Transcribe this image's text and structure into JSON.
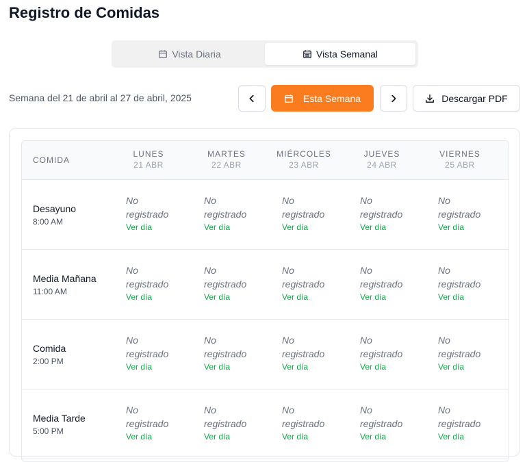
{
  "title": "Registro de Comidas",
  "view_toggle": {
    "daily": "Vista Diaria",
    "weekly": "Vista Semanal",
    "selected": "weekly"
  },
  "week_label": "Semana del 21 de abril al 27 de abril, 2025",
  "controls": {
    "this_week": "Esta Semana",
    "download_pdf": "Descargar PDF"
  },
  "colors": {
    "accent": "#fb7c1f",
    "link": "#16a34a"
  },
  "table": {
    "meal_header": "COMIDA",
    "days": [
      {
        "name": "LUNES",
        "date": "21 ABR"
      },
      {
        "name": "MARTES",
        "date": "22 ABR"
      },
      {
        "name": "MIÉRCOLES",
        "date": "23 ABR"
      },
      {
        "name": "JUEVES",
        "date": "24 ABR"
      },
      {
        "name": "VIERNES",
        "date": "25 ABR"
      }
    ],
    "rows": [
      {
        "meal": "Desayuno",
        "time": "8:00 AM"
      },
      {
        "meal": "Media Mañana",
        "time": "11:00 AM"
      },
      {
        "meal": "Comida",
        "time": "2:00 PM"
      },
      {
        "meal": "Media Tarde",
        "time": "5:00 PM"
      }
    ],
    "cell_status_line1": "No",
    "cell_status_line2": "registrado",
    "cell_link": "Ver día"
  }
}
